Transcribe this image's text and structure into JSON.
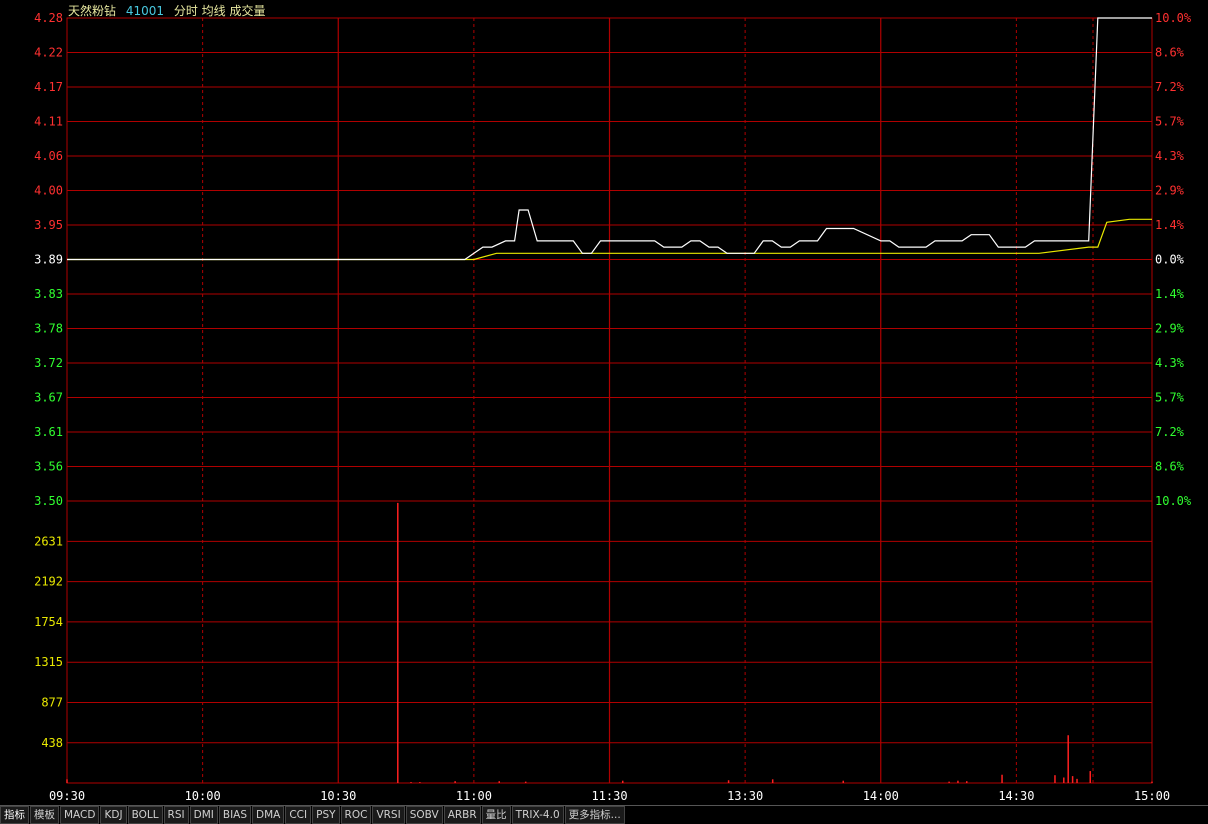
{
  "header": {
    "name": "天然粉钻",
    "code": "41001",
    "label": "分时 均线 成交量"
  },
  "colors": {
    "up": "#ff3030",
    "down": "#30ff30",
    "neutral": "#ffffff",
    "grid": "#b00000",
    "price_line": "#ffffff",
    "avg_line": "#e8e800",
    "volume": "#ff2020",
    "volume_label": "#e8e800"
  },
  "tabs": [
    "指标",
    "模板",
    "MACD",
    "KDJ",
    "BOLL",
    "RSI",
    "DMI",
    "BIAS",
    "DMA",
    "CCI",
    "PSY",
    "ROC",
    "VRSI",
    "SOBV",
    "ARBR",
    "量比",
    "TRIX-4.0",
    "更多指标..."
  ],
  "chart_data": {
    "type": "line",
    "prev_close": 3.89,
    "price_ylim": [
      3.5,
      4.28
    ],
    "price_ticks": [
      "4.28",
      "4.22",
      "4.17",
      "4.11",
      "4.06",
      "4.00",
      "3.95",
      "3.89",
      "3.83",
      "3.78",
      "3.72",
      "3.67",
      "3.61",
      "3.56",
      "3.50"
    ],
    "pct_ticks": [
      "10.0%",
      "8.6%",
      "7.2%",
      "5.7%",
      "4.3%",
      "2.9%",
      "1.4%",
      "0.0%",
      "1.4%",
      "2.9%",
      "4.3%",
      "5.7%",
      "7.2%",
      "8.6%",
      "10.0%"
    ],
    "volume_ylim": [
      0,
      3070
    ],
    "volume_ticks": [
      "2631",
      "2192",
      "1754",
      "1315",
      "877",
      "438"
    ],
    "x_ticks": [
      "09:30",
      "10:00",
      "10:30",
      "11:00",
      "11:30",
      "13:30",
      "14:00",
      "14:30",
      "15:00"
    ],
    "session_minutes": 240,
    "series": [
      {
        "name": "分时",
        "x": [
          0,
          88,
          90,
          92,
          94,
          97,
          99,
          100,
          102,
          104,
          106,
          108,
          112,
          114,
          116,
          118,
          122,
          124,
          130,
          132,
          134,
          136,
          138,
          140,
          142,
          144,
          146,
          152,
          154,
          156,
          158,
          160,
          162,
          166,
          168,
          172,
          174,
          180,
          182,
          184,
          190,
          192,
          194,
          198,
          200,
          204,
          206,
          212,
          214,
          216,
          220,
          222,
          226,
          228,
          232,
          234,
          236,
          238,
          240
        ],
        "y": [
          3.89,
          3.89,
          3.9,
          3.91,
          3.91,
          3.92,
          3.92,
          3.97,
          3.97,
          3.92,
          3.92,
          3.92,
          3.92,
          3.9,
          3.9,
          3.92,
          3.92,
          3.92,
          3.92,
          3.91,
          3.91,
          3.91,
          3.92,
          3.92,
          3.91,
          3.91,
          3.9,
          3.9,
          3.92,
          3.92,
          3.91,
          3.91,
          3.92,
          3.92,
          3.94,
          3.94,
          3.94,
          3.92,
          3.92,
          3.91,
          3.91,
          3.92,
          3.92,
          3.92,
          3.93,
          3.93,
          3.91,
          3.91,
          3.92,
          3.92,
          3.92,
          3.92,
          3.92,
          4.28,
          4.28,
          4.28,
          4.28,
          4.28,
          4.28
        ]
      },
      {
        "name": "均线",
        "x": [
          0,
          88,
          90,
          95,
          100,
          110,
          120,
          140,
          160,
          180,
          200,
          215,
          226,
          228,
          230,
          235,
          240
        ],
        "y": [
          3.89,
          3.89,
          3.89,
          3.9,
          3.9,
          3.9,
          3.9,
          3.9,
          3.9,
          3.9,
          3.9,
          3.9,
          3.91,
          3.91,
          3.95,
          3.955,
          3.955
        ]
      },
      {
        "name": "成交量",
        "x": [
          0,
          75,
          78,
          80,
          88,
          98,
          104,
          126,
          150,
          160,
          176,
          200,
          202,
          204,
          212,
          224,
          226,
          227,
          228,
          229,
          232,
          246
        ],
        "y": [
          40,
          3050,
          10,
          10,
          20,
          20,
          15,
          25,
          30,
          40,
          25,
          15,
          25,
          20,
          90,
          85,
          60,
          520,
          75,
          45,
          130,
          15
        ]
      }
    ]
  }
}
